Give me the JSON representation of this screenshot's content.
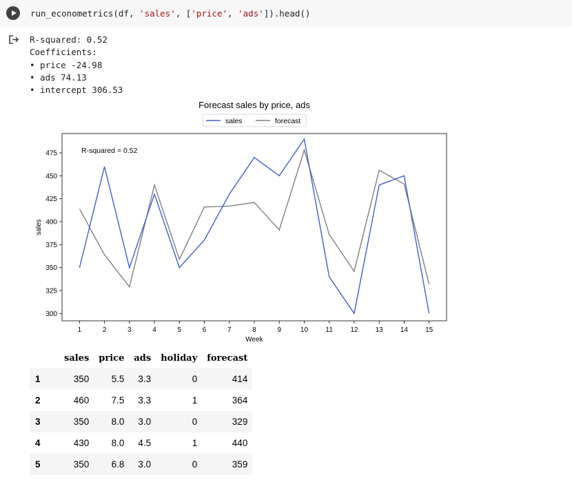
{
  "code_cell": {
    "prefix": "run_econometrics(df, ",
    "arg1": "'sales'",
    "sep1": ", [",
    "arg2": "'price'",
    "sep2": ", ",
    "arg3": "'ads'",
    "suffix": "]).head()"
  },
  "output_lines": [
    "R-squared: 0.52",
    "Coefficients:",
    "• price -24.98",
    "• ads 74.13",
    "• intercept 306.53"
  ],
  "chart_data": {
    "type": "line",
    "title": "Forecast sales by price, ads",
    "xlabel": "Week",
    "ylabel": "sales",
    "annotation": "R-squared = 0.52",
    "x": [
      1,
      2,
      3,
      4,
      5,
      6,
      7,
      8,
      9,
      10,
      11,
      12,
      13,
      14,
      15
    ],
    "xlim": [
      0.3,
      15.7
    ],
    "ylim": [
      292,
      496
    ],
    "yticks": [
      300,
      325,
      350,
      375,
      400,
      425,
      450,
      475
    ],
    "legend": "top-center",
    "series": [
      {
        "name": "sales",
        "color": "#3b5fd4",
        "values": [
          350,
          460,
          350,
          430,
          350,
          380,
          430,
          470,
          450,
          490,
          340,
          300,
          440,
          450,
          300
        ]
      },
      {
        "name": "forecast",
        "color": "#808080",
        "values": [
          414,
          364,
          329,
          440,
          359,
          416,
          417,
          421,
          391,
          478,
          386,
          346,
          456,
          441,
          332
        ]
      }
    ]
  },
  "table": {
    "columns": [
      "sales",
      "price",
      "ads",
      "holiday",
      "forecast"
    ],
    "rows": [
      {
        "idx": "1",
        "cells": [
          "350",
          "5.5",
          "3.3",
          "0",
          "414"
        ]
      },
      {
        "idx": "2",
        "cells": [
          "460",
          "7.5",
          "3.3",
          "1",
          "364"
        ]
      },
      {
        "idx": "3",
        "cells": [
          "350",
          "8.0",
          "3.0",
          "0",
          "329"
        ]
      },
      {
        "idx": "4",
        "cells": [
          "430",
          "8.0",
          "4.5",
          "1",
          "440"
        ]
      },
      {
        "idx": "5",
        "cells": [
          "350",
          "6.8",
          "3.0",
          "0",
          "359"
        ]
      }
    ]
  }
}
